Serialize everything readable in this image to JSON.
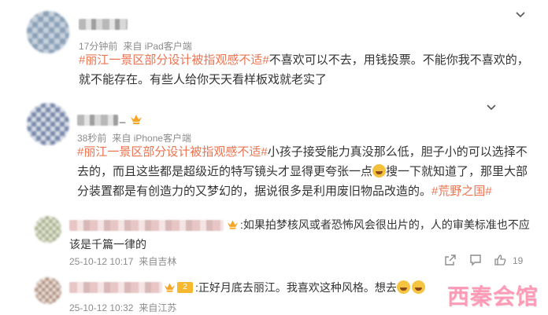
{
  "comment1": {
    "meta_time": "17分钟前",
    "meta_source": "来自 iPad客户端",
    "lines": [
      {
        "tag": "#丽江一景区部分设计被指观感不适#",
        "text": "不喜欢可以不去，用钱投票。不能你我不喜欢的，"
      },
      {
        "tag": "",
        "text": "就不能存在。有些人给你天天看样板戏就老实了"
      }
    ]
  },
  "comment2": {
    "name_suffix": "_",
    "meta_time": "38秒前",
    "meta_source": "来自 iPhone客户端",
    "line1_tag": "#丽江一景区部分设计被指观感不适#",
    "line1_text": "小孩子接受能力真没那么低，胆子小的可以选择不",
    "line2_a": "去的，而且这些都是超级近的特写镜头才显得更夸张一点",
    "line2_b": "搜一下就知道了，那里大部",
    "line3_text": "分装置都是有创造力的又梦幻的，据说很多是利用废旧物品改造的。",
    "line3_tag": "#荒野之国#"
  },
  "reply1": {
    "text_a": ":如果拍梦核风或者恐怖风会很出片的，人的审美标准也不应",
    "text_b": "该是千篇一律的",
    "meta_time": "25-10-12 10:17",
    "meta_source": "来自吉林",
    "like_count": "19"
  },
  "reply2": {
    "text": ":正好月底去丽江。我喜欢这种风格。想去",
    "meta_time": "25-10-12 10:32",
    "meta_source": "来自江苏",
    "badge": "2"
  },
  "watermark": "西秦会馆",
  "colors": {
    "tag": "#eb7350",
    "meta": "#8c8c8c",
    "text": "#333333"
  }
}
